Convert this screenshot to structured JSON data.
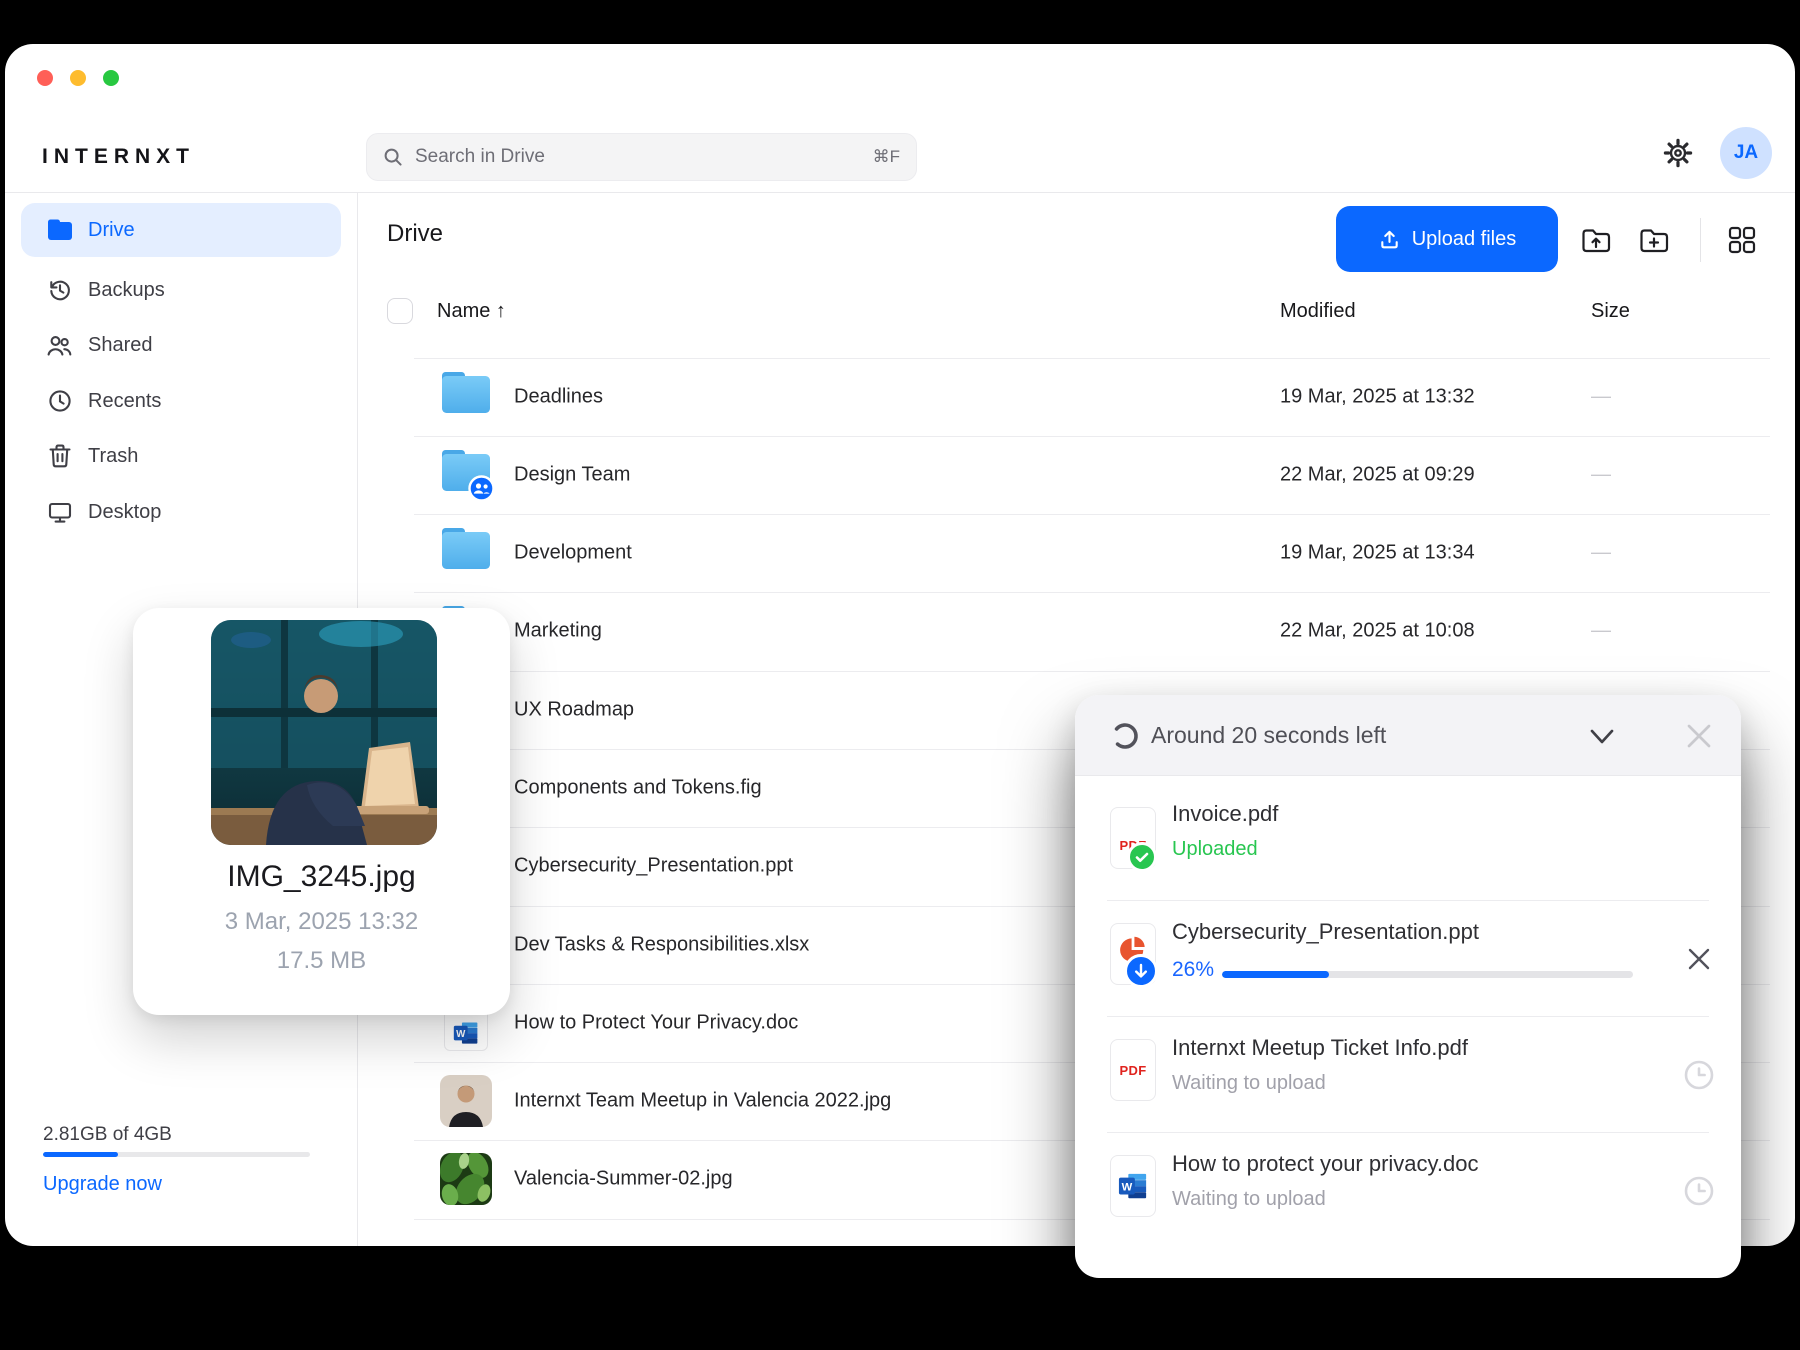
{
  "header": {
    "logo": "INTERNXT",
    "search_placeholder": "Search in Drive",
    "search_shortcut": "⌘F",
    "avatar_initials": "JA"
  },
  "sidebar": {
    "items": [
      {
        "label": "Drive",
        "active": true
      },
      {
        "label": "Backups"
      },
      {
        "label": "Shared"
      },
      {
        "label": "Recents"
      },
      {
        "label": "Trash"
      },
      {
        "label": "Desktop"
      }
    ],
    "storage": {
      "usage": "2.81GB of 4GB",
      "percent": 28,
      "upgrade": "Upgrade now"
    }
  },
  "main": {
    "title": "Drive",
    "upload_button": "Upload files",
    "columns": {
      "name": "Name",
      "sort_arrow": "↑",
      "modified": "Modified",
      "size": "Size"
    },
    "rows": [
      {
        "name": "Deadlines",
        "modified": "19 Mar, 2025 at 13:32",
        "size": "—",
        "icon": "folder"
      },
      {
        "name": "Design Team",
        "modified": "22 Mar, 2025 at 09:29",
        "size": "—",
        "icon": "folder-shared"
      },
      {
        "name": "Development",
        "modified": "19 Mar, 2025 at 13:34",
        "size": "—",
        "icon": "folder"
      },
      {
        "name": "Marketing",
        "modified": "22 Mar, 2025 at 10:08",
        "size": "—",
        "icon": "folder"
      },
      {
        "name": "UX Roadmap",
        "modified": "",
        "size": "",
        "icon": "folder"
      },
      {
        "name": "Components and Tokens.fig",
        "modified": "",
        "size": "",
        "icon": "file"
      },
      {
        "name": "Cybersecurity_Presentation.ppt",
        "modified": "",
        "size": "",
        "icon": "file"
      },
      {
        "name": "Dev Tasks & Responsibilities.xlsx",
        "modified": "",
        "size": "",
        "icon": "file"
      },
      {
        "name": "How to Protect Your Privacy.doc",
        "modified": "",
        "size": "",
        "icon": "word"
      },
      {
        "name": "Internxt Team Meetup in Valencia 2022.jpg",
        "modified": "",
        "size": "",
        "icon": "photo-portrait"
      },
      {
        "name": "Valencia-Summer-02.jpg",
        "modified": "",
        "size": "",
        "icon": "photo-leaves"
      }
    ]
  },
  "preview_card": {
    "filename": "IMG_3245.jpg",
    "date": "3 Mar, 2025 13:32",
    "size": "17.5 MB"
  },
  "upload_panel": {
    "status": "Around 20 seconds left",
    "items": [
      {
        "name": "Invoice.pdf",
        "status": "Uploaded",
        "state": "done",
        "type": "pdf"
      },
      {
        "name": "Cybersecurity_Presentation.ppt",
        "status": "26%",
        "percent": 26,
        "state": "uploading",
        "type": "ppt"
      },
      {
        "name": "Internxt Meetup Ticket Info.pdf",
        "status": "Waiting to upload",
        "state": "waiting",
        "type": "pdf"
      },
      {
        "name": "How to protect your privacy.doc",
        "status": "Waiting to upload",
        "state": "waiting",
        "type": "word"
      }
    ]
  },
  "colors": {
    "accent": "#0B68FF",
    "green": "#28C650",
    "pdf_red": "#E0231E",
    "ppt_orange": "#E8542F"
  }
}
